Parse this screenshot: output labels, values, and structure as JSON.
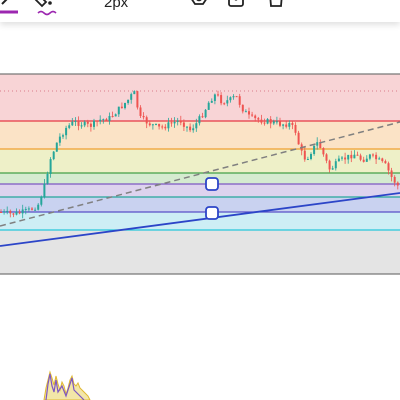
{
  "toolbar": {
    "width_label": "2px",
    "tools": [
      {
        "name": "pencil-icon"
      },
      {
        "name": "fill-color-icon"
      },
      {
        "name": "line-width-icon"
      },
      {
        "name": "line-style-icon"
      },
      {
        "name": "settings-icon"
      },
      {
        "name": "lock-icon"
      },
      {
        "name": "delete-icon"
      },
      {
        "name": "more-icon"
      }
    ]
  },
  "colors": {
    "accent": "#9c27b0",
    "trendline": "#2c45c8",
    "dashed_trendline": "#808080",
    "fib_red": "#e53945",
    "fib_orange": "#f0a030",
    "fib_green": "#43a047",
    "fib_purple": "#7e57c2",
    "fib_teal": "#26a69a",
    "fib_cyan": "#26c6da",
    "candle_up": "#26a69a",
    "candle_down": "#ef5350"
  }
}
